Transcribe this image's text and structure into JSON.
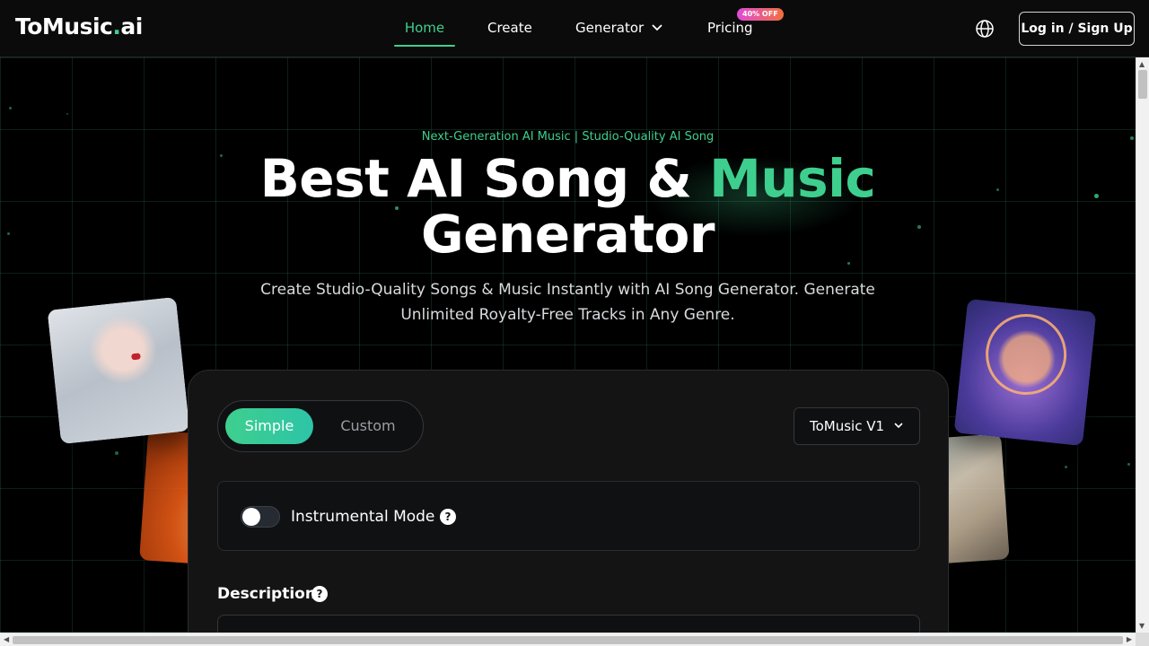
{
  "nav": {
    "logo_main": "ToMusic",
    "logo_dot": ".",
    "logo_tld": "ai",
    "items": [
      {
        "label": "Home",
        "active": true
      },
      {
        "label": "Create"
      },
      {
        "label": "Generator",
        "has_dropdown": true
      },
      {
        "label": "Pricing"
      }
    ],
    "pricing_badge": "40% OFF",
    "language_icon": "globe-icon",
    "login_label": "Log in / Sign Up"
  },
  "hero": {
    "eyebrow": "Next-Generation AI Music | Studio-Quality AI Song",
    "headline_part1": "Best AI Song & ",
    "headline_accent": "Music",
    "headline_part2": "Generator",
    "subtitle": "Create Studio-Quality Songs & Music Instantly with AI Song Generator. Generate Unlimited Royalty-Free Tracks in Any Genre."
  },
  "generator": {
    "mode_simple": "Simple",
    "mode_custom": "Custom",
    "selected_mode": "Simple",
    "model_value": "ToMusic V1",
    "instrumental_label": "Instrumental Mode",
    "instrumental_enabled": false,
    "help_glyph": "?",
    "description_label": "Description"
  },
  "colors": {
    "accent": "#3ecf8e",
    "background": "#000000",
    "panel": "#141415",
    "badge_gradient_start": "#e04bd7",
    "badge_gradient_end": "#f26f3c"
  }
}
